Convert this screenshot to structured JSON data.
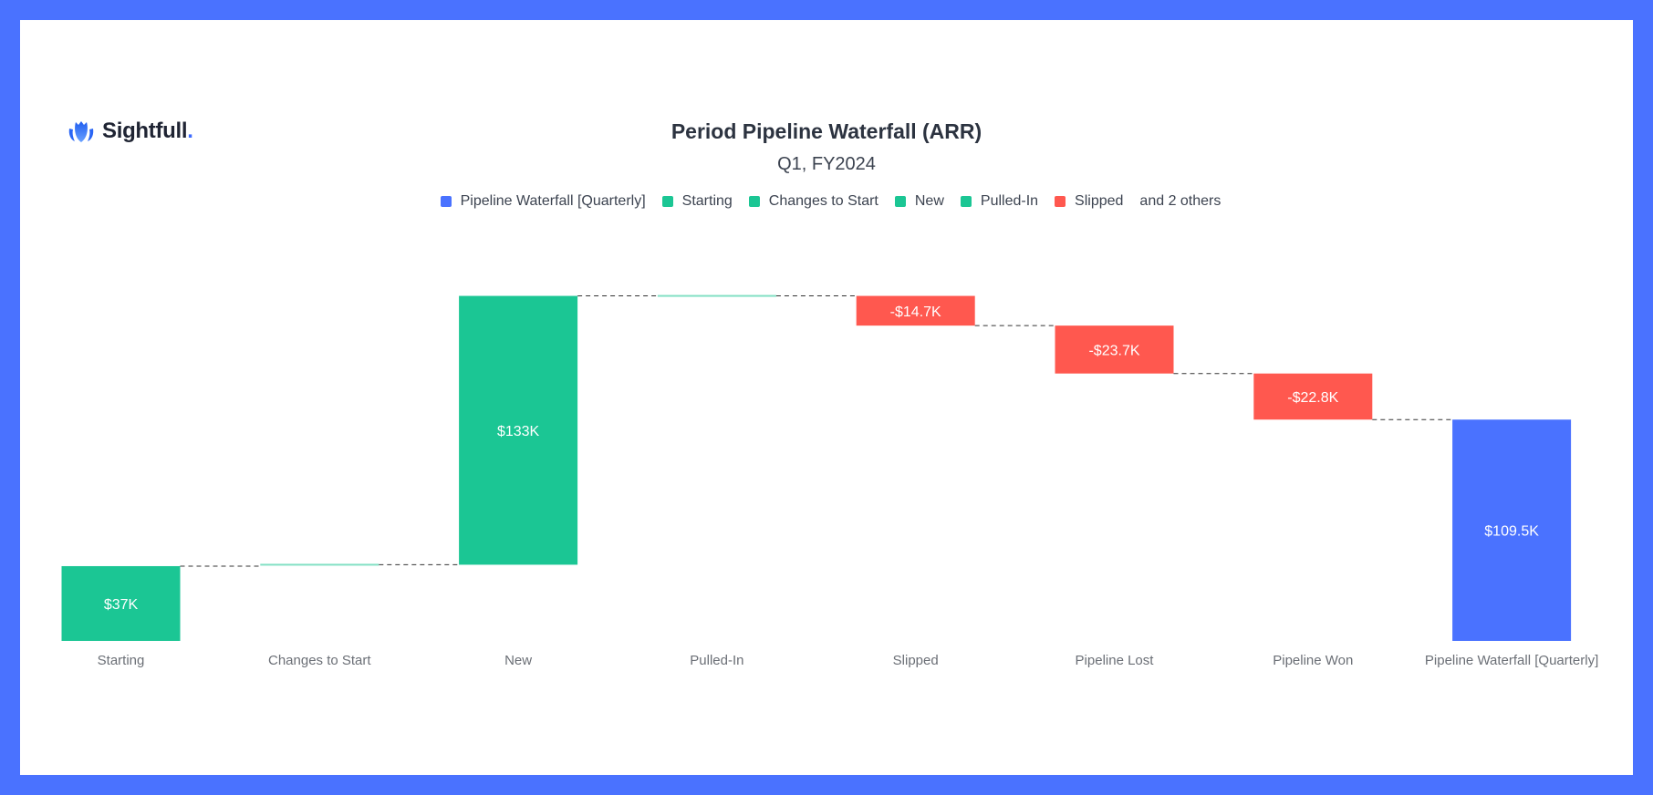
{
  "brand": {
    "name": "Sightfull",
    "dot": ".",
    "icon": "lotus-logo-icon"
  },
  "colors": {
    "total": "#4a72ff",
    "increase": "#1bc694",
    "decrease": "#ff584f",
    "connector": "#333333",
    "frame": "#4a72ff"
  },
  "chart_data": {
    "type": "waterfall",
    "title": "Period Pipeline Waterfall (ARR)",
    "subtitle": "Q1, FY2024",
    "legend": {
      "placement": "top-center",
      "items": [
        {
          "label": "Pipeline Waterfall [Quarterly]",
          "kind": "total"
        },
        {
          "label": "Starting",
          "kind": "increase"
        },
        {
          "label": "Changes to Start",
          "kind": "increase"
        },
        {
          "label": "New",
          "kind": "increase"
        },
        {
          "label": "Pulled-In",
          "kind": "increase"
        },
        {
          "label": "Slipped",
          "kind": "decrease"
        }
      ],
      "more": "and 2 others"
    },
    "categories": [
      "Starting",
      "Changes to Start",
      "New",
      "Pulled-In",
      "Slipped",
      "Pipeline Lost",
      "Pipeline Won",
      "Pipeline Waterfall [Quarterly]"
    ],
    "values": [
      37,
      0.7,
      133,
      0,
      -14.7,
      -23.7,
      -22.8,
      109.5
    ],
    "kinds": [
      "increase",
      "increase",
      "increase",
      "increase",
      "decrease",
      "decrease",
      "decrease",
      "total"
    ],
    "data_labels": [
      "$37K",
      "",
      "$133K",
      "",
      "-$14.7K",
      "-$23.7K",
      "-$22.8K",
      "$109.5K"
    ],
    "unit": "K USD",
    "ylim": [
      0,
      175
    ],
    "grid": false,
    "xlabel": "",
    "ylabel": ""
  }
}
